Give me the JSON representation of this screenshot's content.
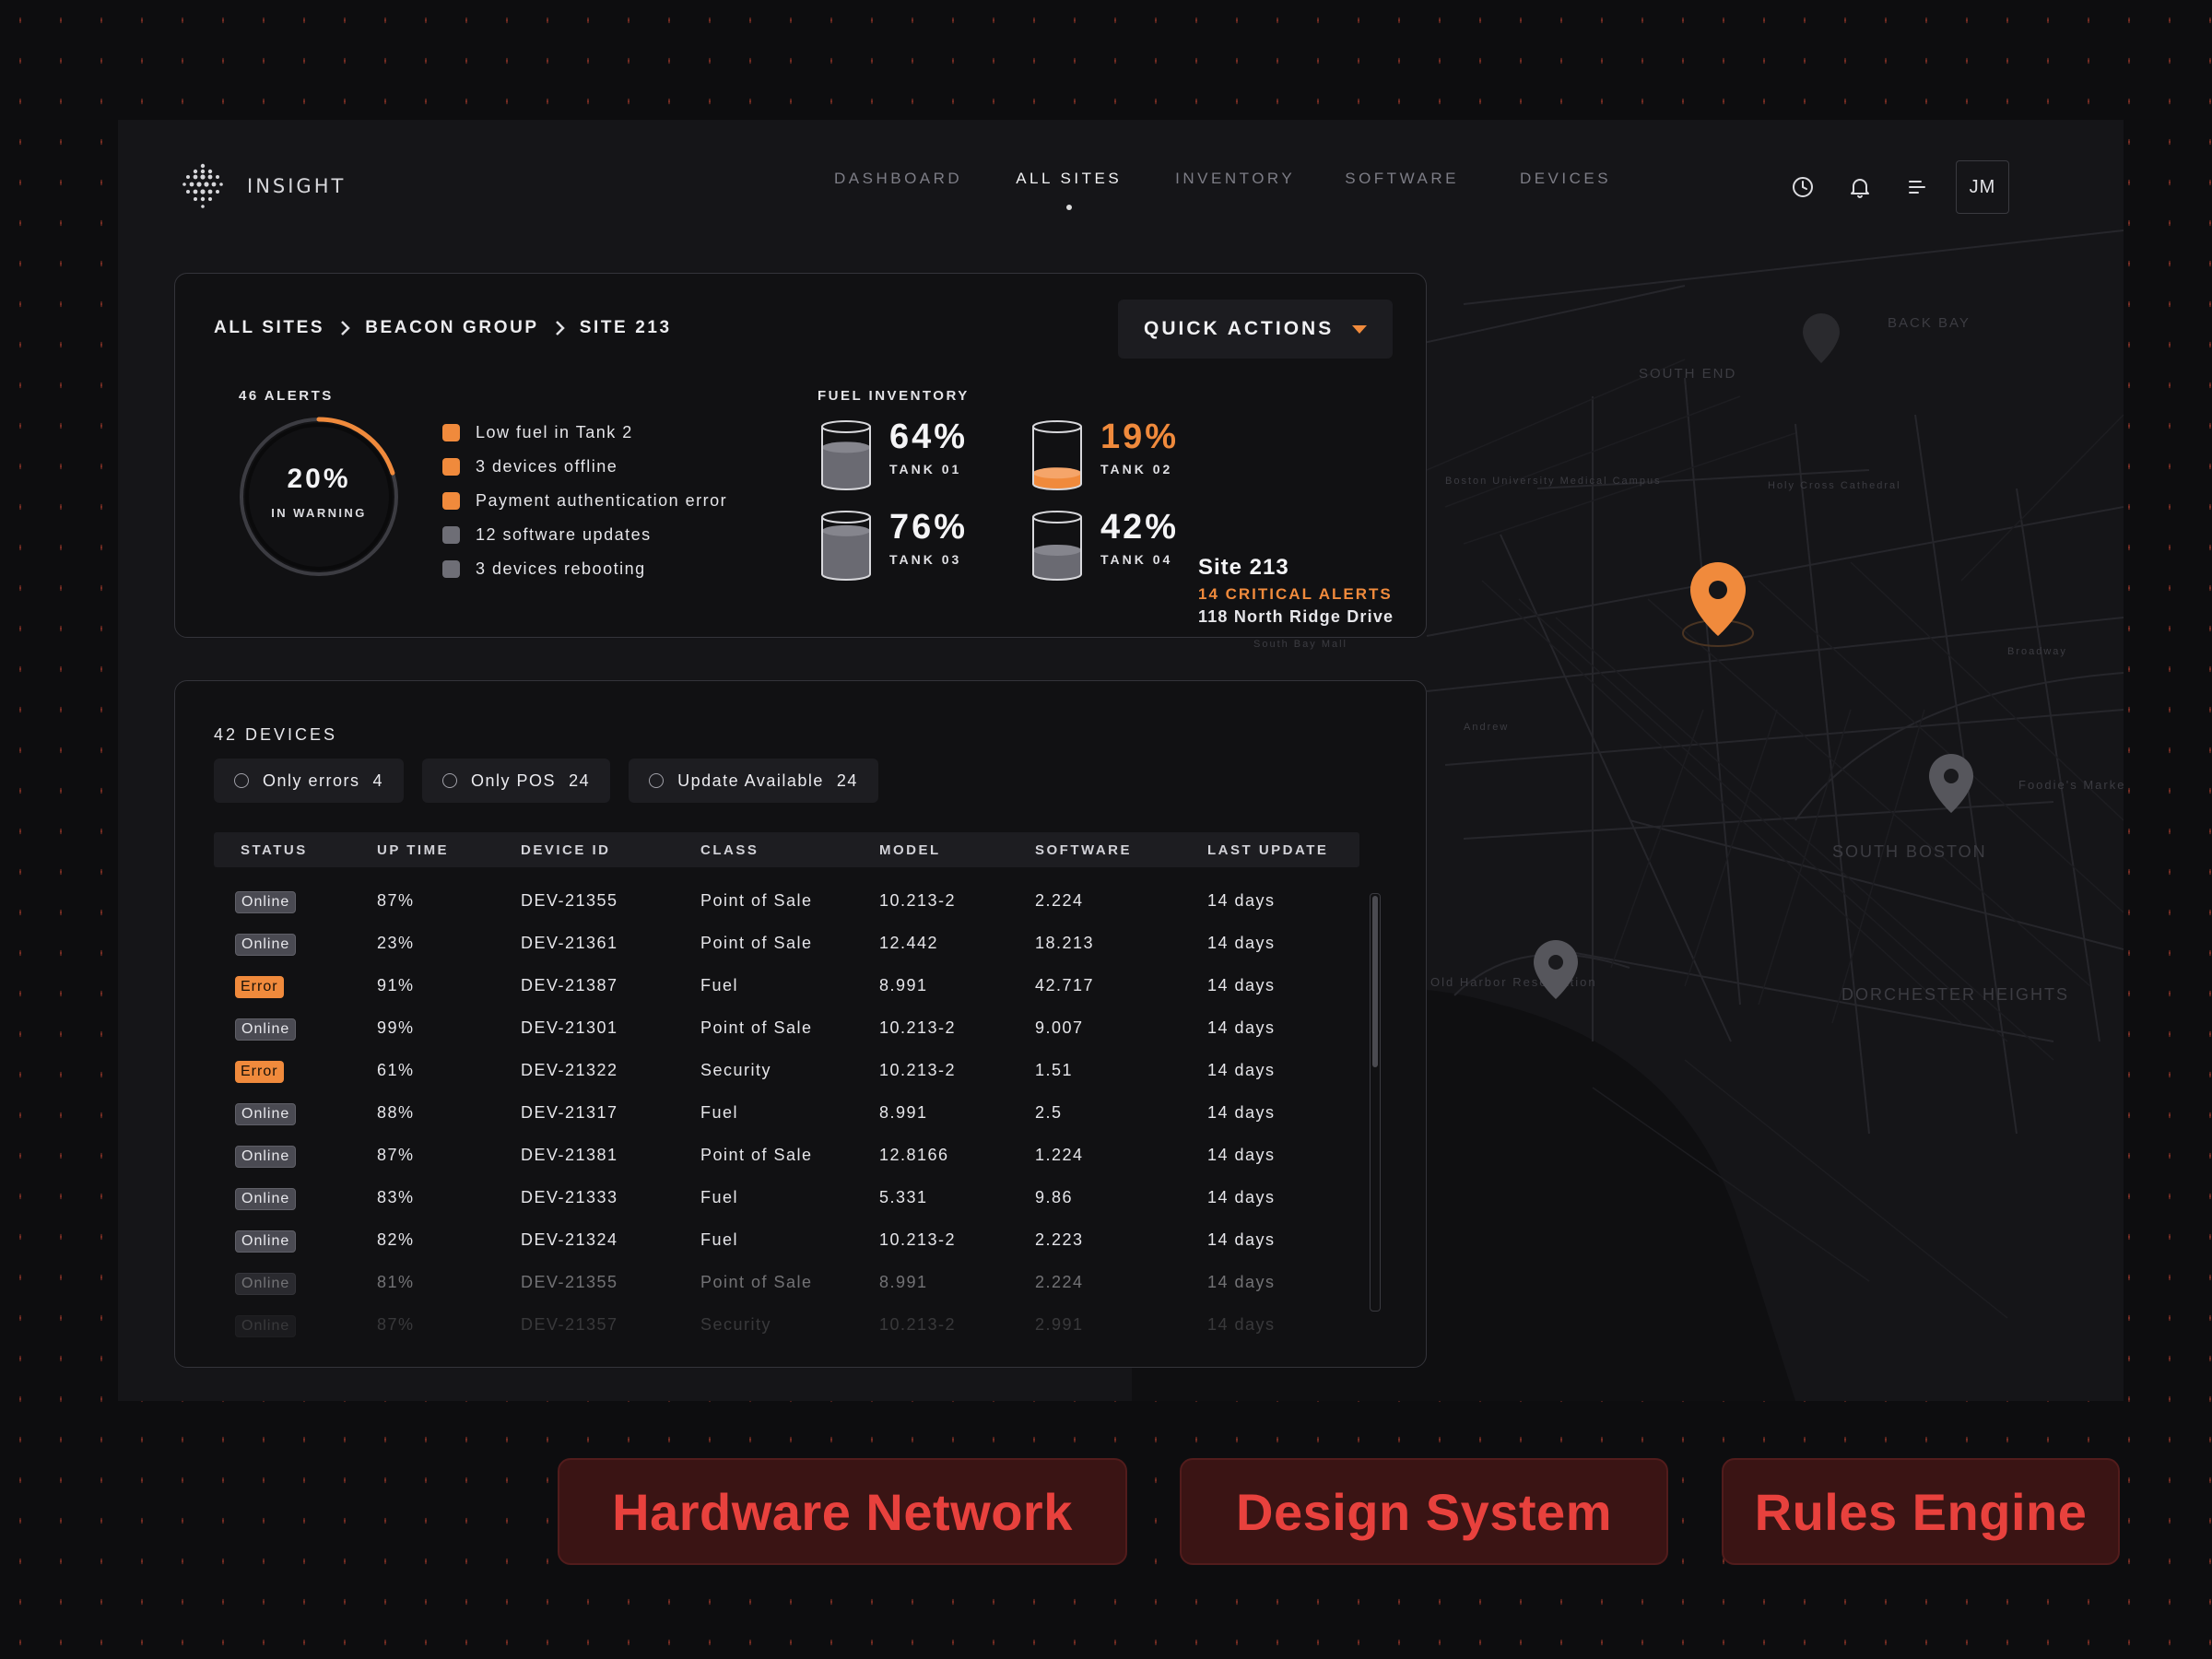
{
  "app": {
    "name": "INSIGHT",
    "avatar": "JM"
  },
  "nav": [
    {
      "label": "DASHBOARD",
      "active": false
    },
    {
      "label": "ALL SITES",
      "active": true
    },
    {
      "label": "INVENTORY",
      "active": false
    },
    {
      "label": "SOFTWARE",
      "active": false
    },
    {
      "label": "DEVICES",
      "active": false
    }
  ],
  "header_icons": [
    "clock-icon",
    "bell-icon",
    "menu-icon"
  ],
  "breadcrumb": [
    "ALL SITES",
    "BEACON GROUP",
    "SITE 213"
  ],
  "quick_actions": "QUICK ACTIONS",
  "alerts": {
    "label": "46 ALERTS",
    "gauge_value": "20%",
    "gauge_sublabel": "IN WARNING",
    "gauge_fraction": 0.2,
    "items": [
      {
        "text": "Low fuel in Tank 2",
        "color": "#f08a3c"
      },
      {
        "text": "3 devices offline",
        "color": "#f08a3c"
      },
      {
        "text": "Payment authentication error",
        "color": "#f08a3c"
      },
      {
        "text": "12 software updates",
        "color": "#6e6e76"
      },
      {
        "text": "3 devices rebooting",
        "color": "#6e6e76"
      }
    ]
  },
  "fuel": {
    "label": "FUEL INVENTORY",
    "tanks": [
      {
        "pct": "64%",
        "name": "TANK 01",
        "level": 0.64,
        "low": false
      },
      {
        "pct": "19%",
        "name": "TANK 02",
        "level": 0.19,
        "low": true
      },
      {
        "pct": "76%",
        "name": "TANK 03",
        "level": 0.76,
        "low": false
      },
      {
        "pct": "42%",
        "name": "TANK 04",
        "level": 0.42,
        "low": false
      }
    ]
  },
  "devices": {
    "title": "42 DEVICES",
    "filters": [
      {
        "label": "Only errors",
        "count": "4"
      },
      {
        "label": "Only POS",
        "count": "24"
      },
      {
        "label": "Update Available",
        "count": "24"
      }
    ],
    "columns": [
      "STATUS",
      "UP TIME",
      "DEVICE ID",
      "CLASS",
      "MODEL",
      "SOFTWARE",
      "LAST UPDATE"
    ],
    "rows": [
      {
        "status": "Online",
        "uptime": "87%",
        "id": "DEV-21355",
        "class": "Point of Sale",
        "model": "10.213-2",
        "software": "2.224",
        "updated": "14 days"
      },
      {
        "status": "Online",
        "uptime": "23%",
        "id": "DEV-21361",
        "class": "Point of Sale",
        "model": "12.442",
        "software": "18.213",
        "updated": "14 days"
      },
      {
        "status": "Error",
        "uptime": "91%",
        "id": "DEV-21387",
        "class": "Fuel",
        "model": "8.991",
        "software": "42.717",
        "updated": "14 days"
      },
      {
        "status": "Online",
        "uptime": "99%",
        "id": "DEV-21301",
        "class": "Point of Sale",
        "model": "10.213-2",
        "software": "9.007",
        "updated": "14 days"
      },
      {
        "status": "Error",
        "uptime": "61%",
        "id": "DEV-21322",
        "class": "Security",
        "model": "10.213-2",
        "software": "1.51",
        "updated": "14 days"
      },
      {
        "status": "Online",
        "uptime": "88%",
        "id": "DEV-21317",
        "class": "Fuel",
        "model": "8.991",
        "software": "2.5",
        "updated": "14 days"
      },
      {
        "status": "Online",
        "uptime": "87%",
        "id": "DEV-21381",
        "class": "Point of Sale",
        "model": "12.8166",
        "software": "1.224",
        "updated": "14 days"
      },
      {
        "status": "Online",
        "uptime": "83%",
        "id": "DEV-21333",
        "class": "Fuel",
        "model": "5.331",
        "software": "9.86",
        "updated": "14 days"
      },
      {
        "status": "Online",
        "uptime": "82%",
        "id": "DEV-21324",
        "class": "Fuel",
        "model": "10.213-2",
        "software": "2.223",
        "updated": "14 days"
      },
      {
        "status": "Online",
        "uptime": "81%",
        "id": "DEV-21355",
        "class": "Point of Sale",
        "model": "8.991",
        "software": "2.224",
        "updated": "14 days"
      },
      {
        "status": "Online",
        "uptime": "87%",
        "id": "DEV-21357",
        "class": "Security",
        "model": "10.213-2",
        "software": "2.991",
        "updated": "14 days"
      }
    ]
  },
  "site": {
    "name": "Site 213",
    "alerts": "14 CRITICAL ALERTS",
    "address": "118 North Ridge Drive"
  },
  "map_labels": [
    "SOUTH END",
    "BACK BAY",
    "SOUTH BOSTON",
    "DORCHESTER HEIGHTS",
    "Broadway",
    "Andrew",
    "Foodie's Market",
    "South Bay Mall",
    "Boston University Medical Campus",
    "Holy Cross Cathedral",
    "Old Harbor Reservation"
  ],
  "tags": [
    "Hardware Network",
    "Design System",
    "Rules Engine"
  ],
  "colors": {
    "accent": "#f08a3c",
    "tag_text": "#e8413d",
    "tag_bg": "#3a1414"
  }
}
